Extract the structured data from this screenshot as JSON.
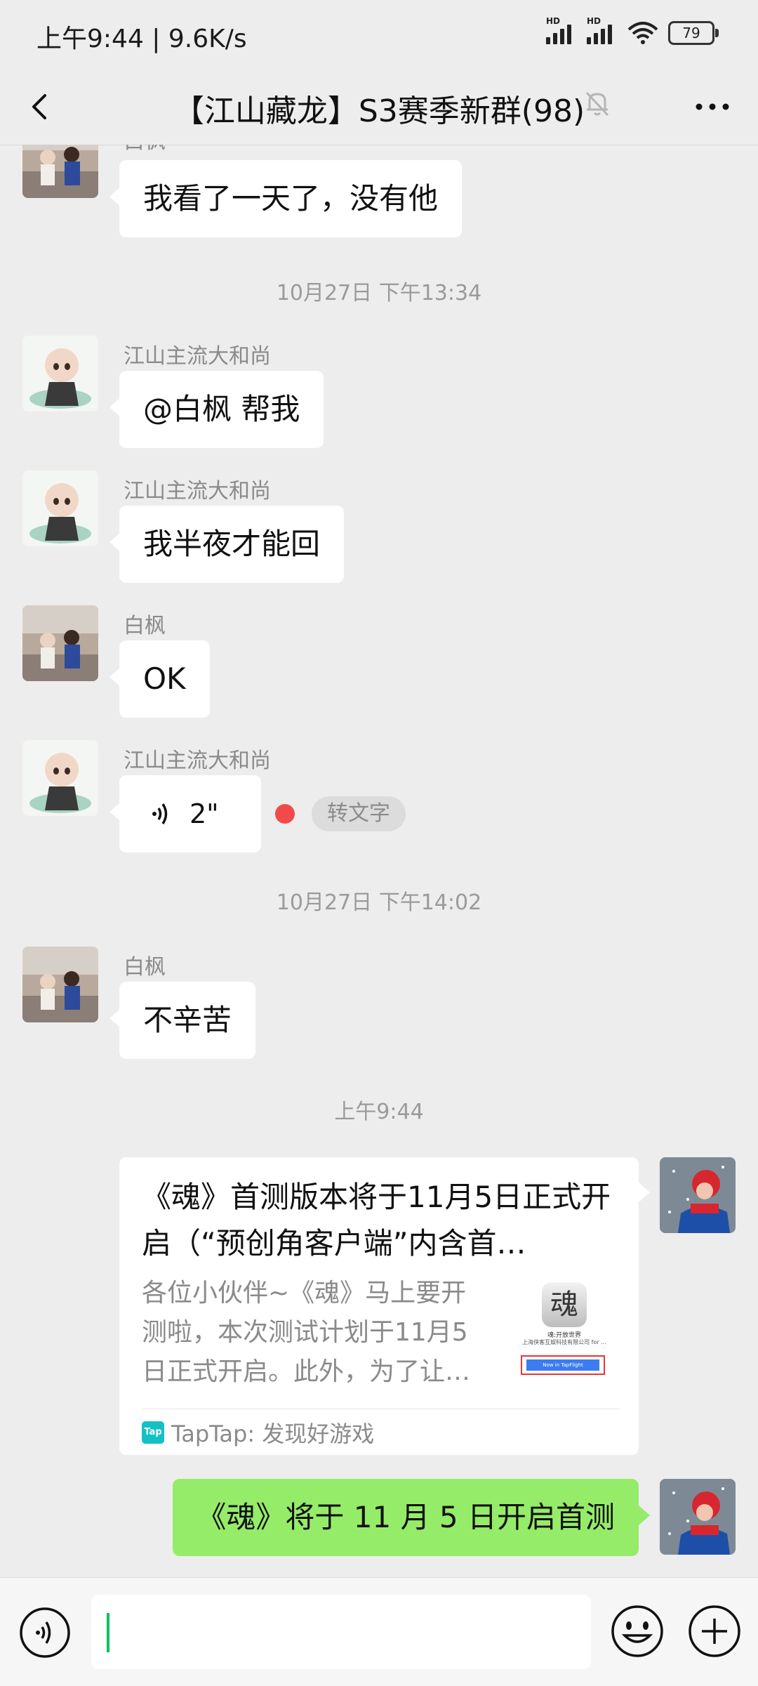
{
  "status_bar": {
    "time": "上午9:44 | 9.6K/s",
    "signal1_label": "HD",
    "signal2_label": "HD",
    "battery": "79"
  },
  "header": {
    "title": "【江山藏龙】S3赛季新群(98)"
  },
  "messages": [
    {
      "type": "text",
      "sender": "白枫",
      "text": "我看了一天了，没有他",
      "avatar": "child-photo-avatar"
    },
    {
      "type": "time",
      "text": "10月27日 下午13:34"
    },
    {
      "type": "text",
      "sender": "江山主流大和尚",
      "text": "@白枫  帮我",
      "avatar": "monk-avatar"
    },
    {
      "type": "text",
      "sender": "江山主流大和尚",
      "text": "我半夜才能回",
      "avatar": "monk-avatar"
    },
    {
      "type": "text",
      "sender": "白枫",
      "text": "OK",
      "avatar": "child-photo-avatar"
    },
    {
      "type": "voice",
      "sender": "江山主流大和尚",
      "duration": "2\"",
      "to_text_label": "转文字",
      "unread": true,
      "avatar": "monk-avatar"
    },
    {
      "type": "time",
      "text": "10月27日 下午14:02"
    },
    {
      "type": "text",
      "sender": "白枫",
      "text": "不辛苦",
      "avatar": "child-photo-avatar"
    },
    {
      "type": "time",
      "text": "上午9:44"
    },
    {
      "type": "link_card",
      "title": "《魂》首测版本将于11月5日正式开启（“预创角客户端”内含首…",
      "description": "各位小伙伴~《魂》马上要开测啦，本次测试计划于11月5日正式开启。此外，为了让…",
      "source": "TapTap: 发现好游戏",
      "thumb_caption": "魂:开放世界",
      "thumb_subcaption": "上海侠客互娱科技有限公司 for ...",
      "thumb_button": "Now in TapFlight",
      "thumb_glyph": "魂",
      "source_logo": "Tap",
      "avatar": "self-avatar"
    },
    {
      "type": "text_self",
      "text": "《魂》将于 11 月 5 日开启首测",
      "avatar": "self-avatar"
    }
  ],
  "colors": {
    "background": "#ededed",
    "self_bubble": "#95ec69",
    "unread_dot": "#f24a4a",
    "caret": "#07c160"
  }
}
